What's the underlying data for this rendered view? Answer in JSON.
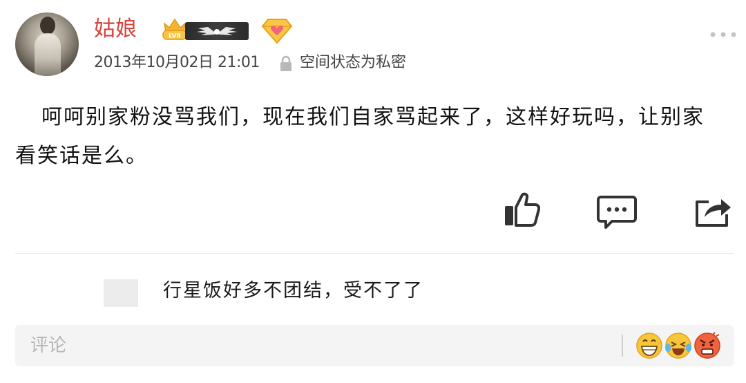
{
  "post": {
    "author": "姑娘",
    "vip_level": "LV8",
    "timestamp": "2013年10月02日  21:01",
    "privacy": "空间状态为私密",
    "content": "呵呵别家粉没骂我们，现在我们自家骂起来了，这样好玩吗，让别家看笑话是么。"
  },
  "reply": {
    "text": "行星饭好多不团结，受不了了"
  },
  "comment_box": {
    "placeholder": "评论"
  },
  "icons": {
    "more": "more-horizontal-icon",
    "lock": "lock-icon",
    "like": "thumbs-up-icon",
    "comment": "comment-bubble-icon",
    "share": "share-icon",
    "emoji": [
      "grinning-emoji",
      "laughing-tears-emoji",
      "angry-emoji"
    ]
  },
  "colors": {
    "author_name": "#d6453d",
    "vip_gold": "#f2b531",
    "diamond_pink": "#f2637e"
  }
}
